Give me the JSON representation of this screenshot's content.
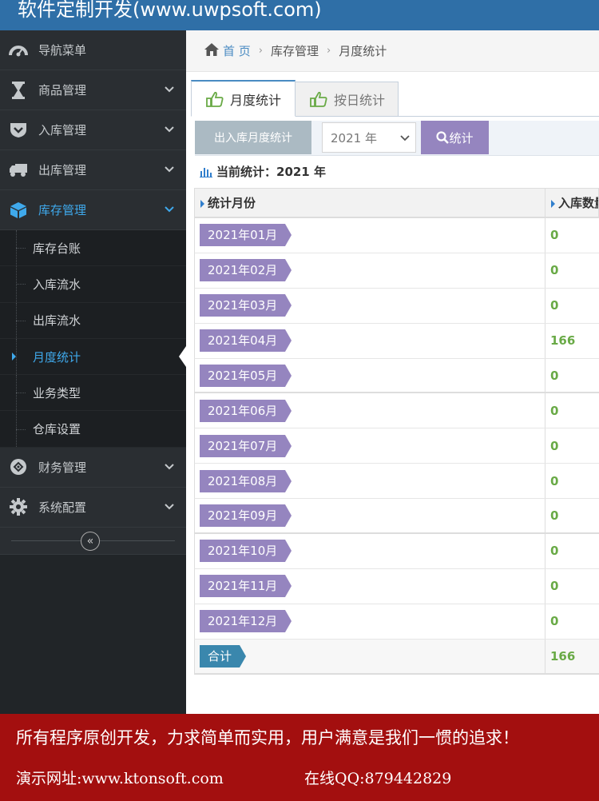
{
  "banner": {
    "title": "软件定制开发(www.uwpsoft.com)"
  },
  "sidebar": {
    "nav_header": "导航菜单",
    "menus": [
      {
        "label": "商品管理",
        "icon": "hourglass-icon"
      },
      {
        "label": "入库管理",
        "icon": "shield-icon"
      },
      {
        "label": "出库管理",
        "icon": "truck-icon"
      },
      {
        "label": "库存管理",
        "icon": "cube-icon"
      },
      {
        "label": "财务管理",
        "icon": "finance-icon"
      },
      {
        "label": "系统配置",
        "icon": "gear-icon"
      }
    ],
    "submenu": [
      {
        "label": "库存台账"
      },
      {
        "label": "入库流水"
      },
      {
        "label": "出库流水"
      },
      {
        "label": "月度统计"
      },
      {
        "label": "业务类型"
      },
      {
        "label": "仓库设置"
      }
    ],
    "collapse_glyph": "«"
  },
  "breadcrumb": {
    "home": "首 页",
    "level1": "库存管理",
    "level2": "月度统计"
  },
  "tabs": [
    {
      "label": "月度统计"
    },
    {
      "label": "按日统计"
    }
  ],
  "toolbar": {
    "title_button": "出入库月度统计",
    "year_value": "2021 年",
    "stat_button": "统计"
  },
  "current_stat": {
    "label": "当前统计：2021 年"
  },
  "table": {
    "headers": [
      "统计月份",
      "入库数量"
    ],
    "rows": [
      {
        "month": "2021年01月",
        "in_qty": "0"
      },
      {
        "month": "2021年02月",
        "in_qty": "0"
      },
      {
        "month": "2021年03月",
        "in_qty": "0"
      },
      {
        "month": "2021年04月",
        "in_qty": "166"
      },
      {
        "month": "2021年05月",
        "in_qty": "0"
      },
      {
        "month": "2021年06月",
        "in_qty": "0"
      },
      {
        "month": "2021年07月",
        "in_qty": "0"
      },
      {
        "month": "2021年08月",
        "in_qty": "0"
      },
      {
        "month": "2021年09月",
        "in_qty": "0"
      },
      {
        "month": "2021年10月",
        "in_qty": "0"
      },
      {
        "month": "2021年11月",
        "in_qty": "0"
      },
      {
        "month": "2021年12月",
        "in_qty": "0"
      }
    ],
    "total_label": "合计",
    "total_in_qty": "166"
  },
  "footer": {
    "slogan": "所有程序原创开发，力求简单而实用，用户满意是我们一惯的追求！",
    "site": "演示网址:www.ktonsoft.com",
    "qq": "在线QQ:879442829"
  },
  "colors": {
    "banner": "#2f6fa7",
    "sidebar": "#212528",
    "active": "#3fa9ec",
    "tag_purple": "#9585bf",
    "tag_blue": "#3a87ad",
    "value_green": "#69aa46",
    "footer": "#a30f0f"
  }
}
